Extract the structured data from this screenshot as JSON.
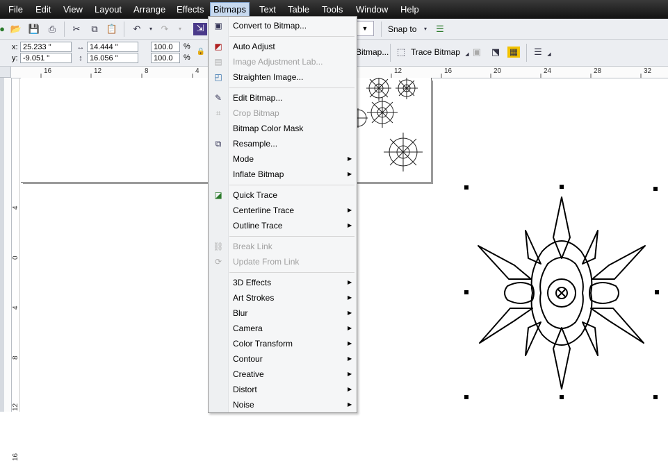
{
  "menubar": {
    "items": [
      "File",
      "Edit",
      "View",
      "Layout",
      "Arrange",
      "Effects",
      "Bitmaps",
      "Text",
      "Table",
      "Tools",
      "Window",
      "Help"
    ],
    "active": "Bitmaps"
  },
  "toolbar": {
    "snap_to_label": "Snap to",
    "bitmap_label": "Bitmap...",
    "trace_bitmap_label": "Trace Bitmap"
  },
  "property_bar": {
    "x_label": "x:",
    "x_value": "25.233 \"",
    "y_label": "y:",
    "y_value": "-9.051 \"",
    "width_value": "14.444 \"",
    "height_value": "16.056 \"",
    "scale_w": "100.0",
    "scale_h": "100.0",
    "percent": "%"
  },
  "rulers": {
    "h_ticks_left": [
      "16",
      "12",
      "8",
      "4"
    ],
    "h_ticks_right": [
      "12",
      "16",
      "20",
      "24",
      "28",
      "32"
    ],
    "v_ticks": [
      "4",
      "0",
      "4",
      "8",
      "12",
      "16"
    ]
  },
  "bitmaps_menu": {
    "items": [
      {
        "label": "Convert to Bitmap...",
        "icon": "convert-bitmap-icon",
        "disabled": false,
        "submenu": false
      },
      {
        "label": "Auto Adjust",
        "icon": "auto-adjust-icon",
        "disabled": false,
        "submenu": false
      },
      {
        "label": "Image Adjustment Lab...",
        "icon": "image-adjustment-icon",
        "disabled": true,
        "submenu": false
      },
      {
        "label": "Straighten Image...",
        "icon": "straighten-icon",
        "disabled": false,
        "submenu": false
      },
      {
        "label": "Edit Bitmap...",
        "icon": "edit-bitmap-icon",
        "disabled": false,
        "submenu": false
      },
      {
        "label": "Crop Bitmap",
        "icon": "crop-bitmap-icon",
        "disabled": true,
        "submenu": false
      },
      {
        "label": "Bitmap Color Mask",
        "icon": "",
        "disabled": false,
        "submenu": false
      },
      {
        "label": "Resample...",
        "icon": "resample-icon",
        "disabled": false,
        "submenu": false
      },
      {
        "label": "Mode",
        "icon": "",
        "disabled": false,
        "submenu": true
      },
      {
        "label": "Inflate Bitmap",
        "icon": "",
        "disabled": false,
        "submenu": true
      },
      {
        "label": "Quick Trace",
        "icon": "quick-trace-icon",
        "disabled": false,
        "submenu": false
      },
      {
        "label": "Centerline Trace",
        "icon": "",
        "disabled": false,
        "submenu": true
      },
      {
        "label": "Outline Trace",
        "icon": "",
        "disabled": false,
        "submenu": true
      },
      {
        "label": "Break Link",
        "icon": "break-link-icon",
        "disabled": true,
        "submenu": false
      },
      {
        "label": "Update From Link",
        "icon": "update-link-icon",
        "disabled": true,
        "submenu": false
      },
      {
        "label": "3D Effects",
        "icon": "",
        "disabled": false,
        "submenu": true
      },
      {
        "label": "Art Strokes",
        "icon": "",
        "disabled": false,
        "submenu": true
      },
      {
        "label": "Blur",
        "icon": "",
        "disabled": false,
        "submenu": true
      },
      {
        "label": "Camera",
        "icon": "",
        "disabled": false,
        "submenu": true
      },
      {
        "label": "Color Transform",
        "icon": "",
        "disabled": false,
        "submenu": true
      },
      {
        "label": "Contour",
        "icon": "",
        "disabled": false,
        "submenu": true
      },
      {
        "label": "Creative",
        "icon": "",
        "disabled": false,
        "submenu": true
      },
      {
        "label": "Distort",
        "icon": "",
        "disabled": false,
        "submenu": true
      },
      {
        "label": "Noise",
        "icon": "",
        "disabled": false,
        "submenu": true
      }
    ]
  }
}
